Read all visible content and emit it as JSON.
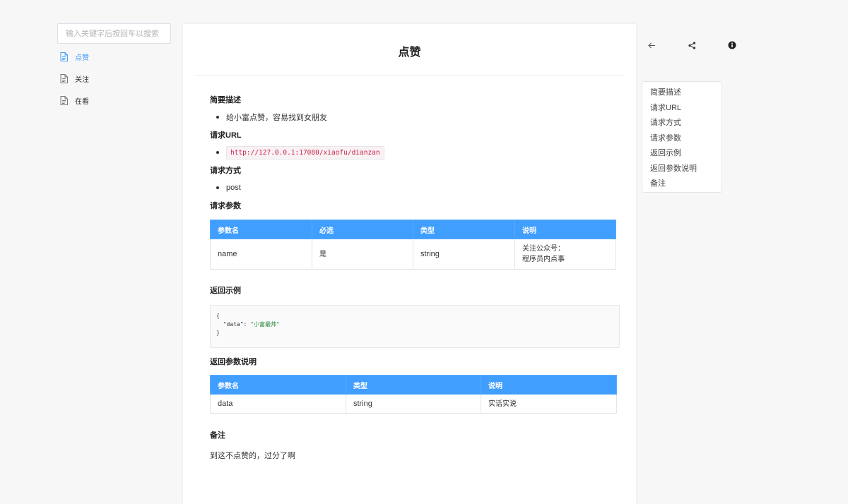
{
  "sidebar": {
    "search_placeholder": "输入关键字后按回车以搜索",
    "items": [
      {
        "label": "点赞",
        "active": true
      },
      {
        "label": "关注",
        "active": false
      },
      {
        "label": "在看",
        "active": false
      }
    ]
  },
  "doc": {
    "title": "点赞",
    "sections": {
      "desc_heading": "简要描述",
      "desc_text": "给小富点赞，容易找到女朋友",
      "url_heading": "请求URL",
      "url_value": "http://127.0.0.1:17080/xiaofu/dianzan",
      "method_heading": "请求方式",
      "method_value": "post",
      "params_heading": "请求参数",
      "params_table": {
        "headers": [
          "参数名",
          "必选",
          "类型",
          "说明"
        ],
        "rows": [
          [
            "name",
            "是",
            "string",
            "关注公众号：",
            "程序员内点事"
          ]
        ]
      },
      "example_heading": "返回示例",
      "example_code": {
        "line1": "{",
        "line2_key": "  \"data\": ",
        "line2_value": "\"小富最帅\"",
        "line3": "}"
      },
      "ret_heading": "返回参数说明",
      "ret_table": {
        "headers": [
          "参数名",
          "类型",
          "说明"
        ],
        "rows": [
          [
            "data",
            "string",
            "实话实说"
          ]
        ]
      },
      "note_heading": "备注",
      "note_text": "到这不点赞的，过分了啊"
    }
  },
  "toolbar": {
    "back_icon": "arrow-left-icon",
    "share_icon": "share-icon",
    "info_icon": "info-icon"
  },
  "toc": [
    "简要描述",
    "请求URL",
    "请求方式",
    "请求参数",
    "返回示例",
    "返回参数说明",
    "备注"
  ],
  "colors": {
    "accent": "#409eff",
    "code_red": "#c7254e",
    "code_green": "#22863a"
  }
}
